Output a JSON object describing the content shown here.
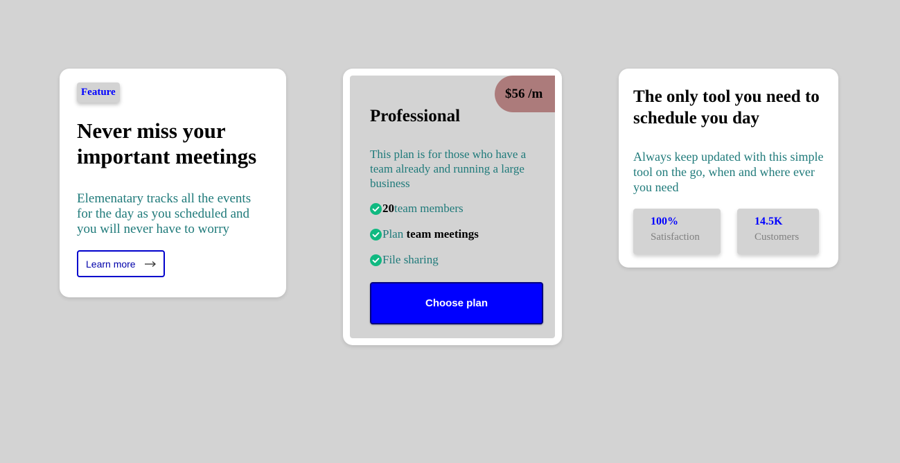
{
  "feature_card": {
    "badge": "Feature",
    "title": "Never miss your important meetings",
    "description": "Elemenatary tracks all the events for the day as you scheduled and you will never have to worry",
    "cta_label": "Learn more",
    "cta_icon": "arrow-right-icon"
  },
  "pricing_card": {
    "price": "$56 /m",
    "plan_name": "Professional",
    "description": "This plan is for those who have a team already and running a large business",
    "features": [
      {
        "icon": "check-circle-icon",
        "strong_lead": "20",
        "text": " team members",
        "strong_tail": ""
      },
      {
        "icon": "check-circle-icon",
        "strong_lead": "",
        "text": "Plan ",
        "strong_tail": "team meetings"
      },
      {
        "icon": "check-circle-icon",
        "strong_lead": "",
        "text": "File sharing",
        "strong_tail": ""
      }
    ],
    "cta_label": "Choose plan"
  },
  "tool_card": {
    "title": "The only tool you need to schedule you day",
    "description": "Always keep updated with this simple tool on the go, when and where ever you need",
    "stats": [
      {
        "value": "100%",
        "label": "Satisfaction"
      },
      {
        "value": "14.5K",
        "label": "Customers"
      }
    ]
  },
  "colors": {
    "background": "#d3d3d3",
    "accent_blue": "#0000ff",
    "teal_text": "#1f7a7a",
    "check_green": "#10b981",
    "price_tag": "#ac7b7b"
  }
}
